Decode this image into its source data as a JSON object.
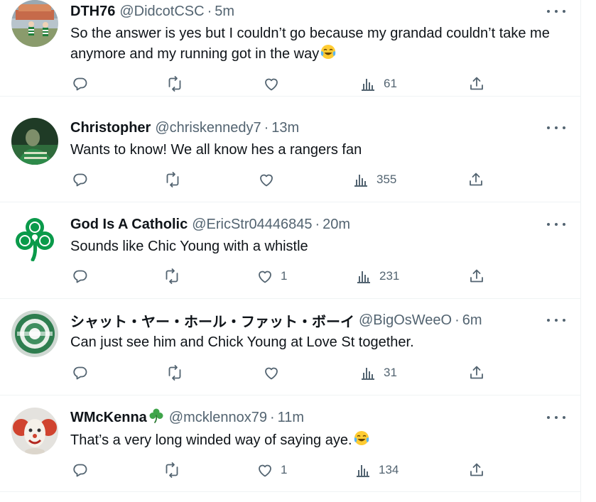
{
  "tweets": [
    {
      "name": "DTH76",
      "handle": "@DidcotCSC",
      "separator": "·",
      "time": "5m",
      "text": "So the answer is yes but I couldn’t go because my grandad couldn’t take me anymore and my running got in the way",
      "text_emoji": "tears-of-joy-emoji",
      "likes": "",
      "views": "61"
    },
    {
      "name": "Christopher",
      "handle": "@chriskennedy7",
      "separator": "·",
      "time": "13m",
      "text": "Wants to know! We all know hes a rangers fan",
      "likes": "",
      "views": "355"
    },
    {
      "name": "God Is A Catholic",
      "handle": "@EricStr04446845",
      "separator": "·",
      "time": "20m",
      "text": "Sounds like Chic Young with a whistle",
      "likes": "1",
      "views": "231"
    },
    {
      "name": "シャット・ヤー・ホール・ファット・ボーイ",
      "handle": "@BigOsWeeO",
      "separator": "·",
      "time": "6m",
      "text": "Can just see him and Chick Young at Love St together.",
      "likes": "",
      "views": "31"
    },
    {
      "name": "WMcKenna",
      "name_emoji": "shamrock-emoji",
      "handle": "@mcklennox79",
      "separator": "·",
      "time": "11m",
      "text": "That’s a very long winded way of saying aye.",
      "text_emoji": "tears-of-joy-emoji",
      "likes": "1",
      "views": "134"
    }
  ],
  "icons": {
    "reply": "reply-icon",
    "retweet": "retweet-icon",
    "like": "like-icon",
    "views": "views-icon",
    "share": "share-icon",
    "more": "more-icon"
  },
  "colors": {
    "text": "#0f1419",
    "secondary": "#536471",
    "divider": "#eff3f4",
    "celtic_green": "#0a7a3a"
  }
}
